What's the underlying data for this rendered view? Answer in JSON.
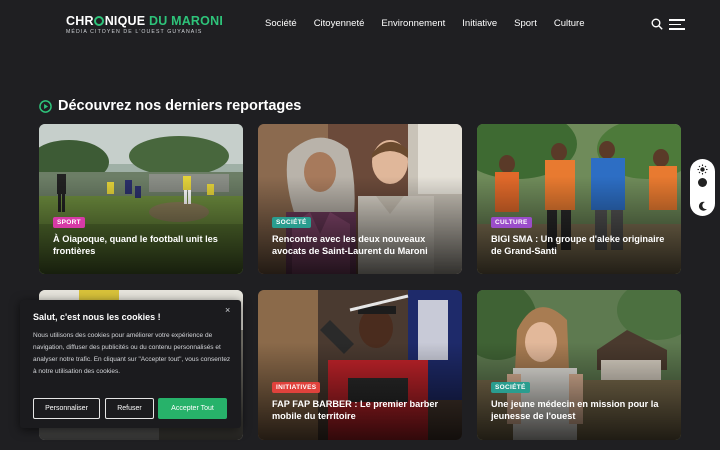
{
  "header": {
    "logo": {
      "part1": "CHR",
      "part2": "NIQUE",
      "part3": "DU MARONI",
      "tagline": "MÉDIA CITOYEN DE L'OUEST GUYANAIS"
    },
    "nav": [
      "Société",
      "Citoyenneté",
      "Environnement",
      "Initiative",
      "Sport",
      "Culture"
    ]
  },
  "section": {
    "title": "Découvrez nos derniers reportages"
  },
  "cards": [
    {
      "tag": "SPORT",
      "tag_color": "#d63aa6",
      "title": "À Oiapoque, quand le football unit les frontières"
    },
    {
      "tag": "SOCIÉTÉ",
      "tag_color": "#2a9d8f",
      "title": "Rencontre avec les deux nouveaux avocats de Saint-Laurent du Maroni"
    },
    {
      "tag": "CULTURE",
      "tag_color": "#9b4dca",
      "title": "BIGI SMA : Un groupe d'aleke originaire de Grand-Santi"
    },
    {
      "tag": "",
      "tag_color": "",
      "title": ""
    },
    {
      "tag": "INITIATIVES",
      "tag_color": "#e0423c",
      "title": "FAP FAP BARBER : Le premier barber mobile du territoire"
    },
    {
      "tag": "SOCIÉTÉ",
      "tag_color": "#2a9d8f",
      "title": "Une jeune médecin en mission pour la jeunesse de l'ouest"
    }
  ],
  "cookie": {
    "title": "Salut, c'est nous les cookies !",
    "text": "Nous utilisons des cookies pour améliorer votre expérience de navigation, diffuser des publicités ou du contenu personnalisés et analyser notre trafic. En cliquant sur \"Accepter tout\", vous consentez à notre utilisation des cookies.",
    "customize": "Personnaliser",
    "refuse": "Refuser",
    "accept": "Accepter Tout",
    "close": "×"
  },
  "colors": {
    "background": "#1f1f22",
    "accent": "#2ec37a",
    "accept_button": "#27b26a"
  }
}
